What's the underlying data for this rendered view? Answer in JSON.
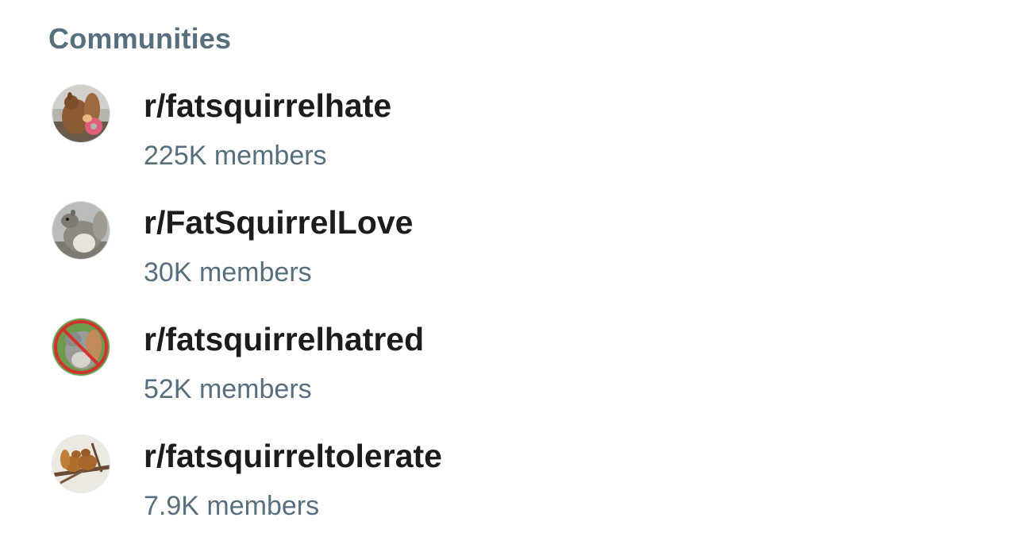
{
  "section": {
    "title": "Communities"
  },
  "communities": [
    {
      "name": "r/fatsquirrelhate",
      "members": "225K members",
      "avatar_icon": "squirrel-eating-donut-avatar"
    },
    {
      "name": "r/FatSquirrelLove",
      "members": "30K members",
      "avatar_icon": "fat-gray-squirrel-avatar"
    },
    {
      "name": "r/fatsquirrelhatred",
      "members": "52K members",
      "avatar_icon": "squirrel-prohibited-avatar"
    },
    {
      "name": "r/fatsquirreltolerate",
      "members": "7.9K members",
      "avatar_icon": "squirrels-on-branch-avatar"
    }
  ],
  "colors": {
    "heading": "#576f7d",
    "name": "#1c1c1c",
    "members": "#576f7d"
  }
}
